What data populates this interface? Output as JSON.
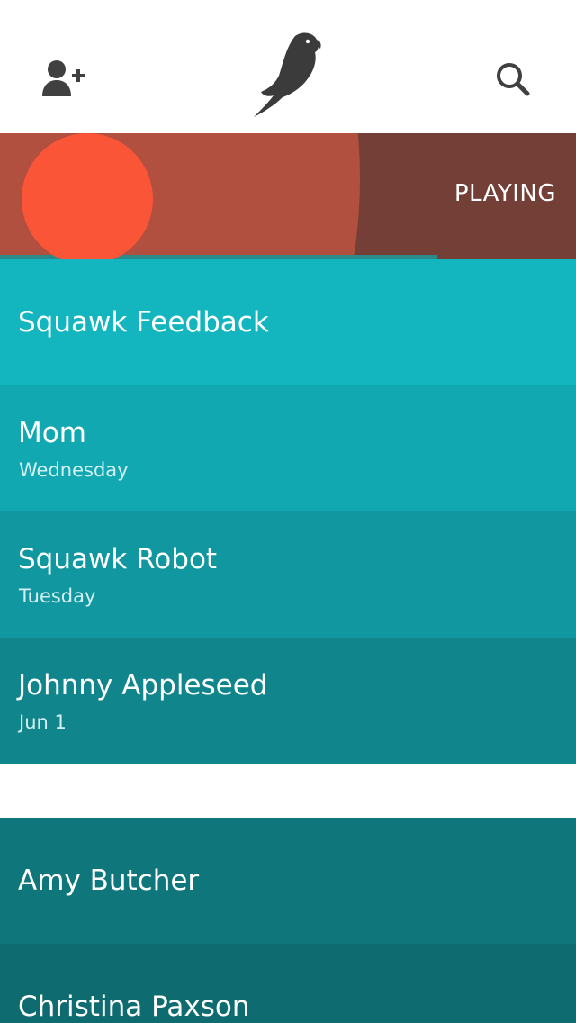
{
  "header": {
    "add_contact_icon": "add-contact-icon",
    "logo_icon": "parrot-logo-icon",
    "search_icon": "search-icon"
  },
  "now_playing": {
    "status": "PLAYING",
    "colors": {
      "background": "#733f36",
      "wave": "#b1503f",
      "dot": "#fb5538"
    }
  },
  "conversations": [
    {
      "name": "Squawk Feedback",
      "date": "",
      "color": "#13b5bf"
    },
    {
      "name": "Mom",
      "date": "Wednesday",
      "color": "#12a8b1"
    },
    {
      "name": "Squawk Robot",
      "date": "Tuesday",
      "color": "#11979f"
    },
    {
      "name": "Johnny Appleseed",
      "date": "Jun 1",
      "color": "#10868c"
    }
  ],
  "conversations_more": [
    {
      "name": "Amy Butcher",
      "date": "",
      "color": "#0f767b"
    },
    {
      "name": "Christina Paxson",
      "date": "",
      "color": "#0e6c71"
    }
  ]
}
